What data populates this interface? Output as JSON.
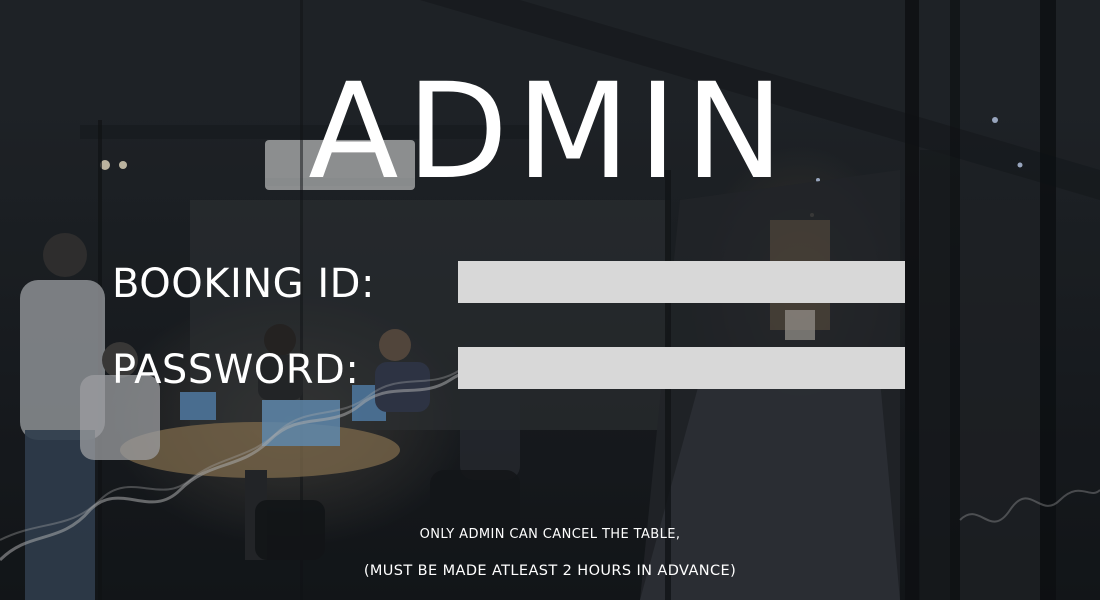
{
  "page": {
    "title": "ADMIN"
  },
  "form": {
    "booking_id_label": "BOOKING ID:",
    "booking_id_value": "",
    "password_label": "PASSWORD:",
    "password_value": ""
  },
  "notes": {
    "line1": "ONLY ADMIN CAN CANCEL THE TABLE,",
    "line2": "(MUST BE MADE ATLEAST 2 HOURS IN ADVANCE)"
  },
  "colors": {
    "text": "#ffffff",
    "input_background": "#d8d8d8",
    "background_dark": "#1c1f23"
  }
}
